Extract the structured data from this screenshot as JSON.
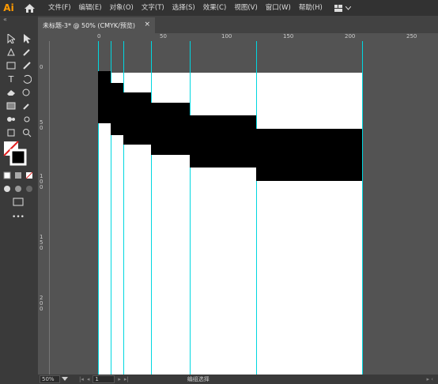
{
  "app": {
    "logo": "Ai"
  },
  "menu": [
    "文件(F)",
    "编辑(E)",
    "对象(O)",
    "文字(T)",
    "选择(S)",
    "效果(C)",
    "视图(V)",
    "窗口(W)",
    "帮助(H)"
  ],
  "document_tab": {
    "title": "未标题-3* @ 50% (CMYK/预览)",
    "close": "×"
  },
  "ruler_h": [
    "0",
    "50",
    "100",
    "150",
    "200",
    "250"
  ],
  "ruler_v": [
    "0",
    "5 0",
    "1 0 0",
    "1 5 0",
    "2 0 0"
  ],
  "status": {
    "zoom": "50%",
    "artboard": "1",
    "mode": "编组选择"
  },
  "colors": {
    "accent": "#ff9a00",
    "guide": "#00d7e0",
    "ui_dark": "#323232",
    "canvas": "#535353"
  }
}
